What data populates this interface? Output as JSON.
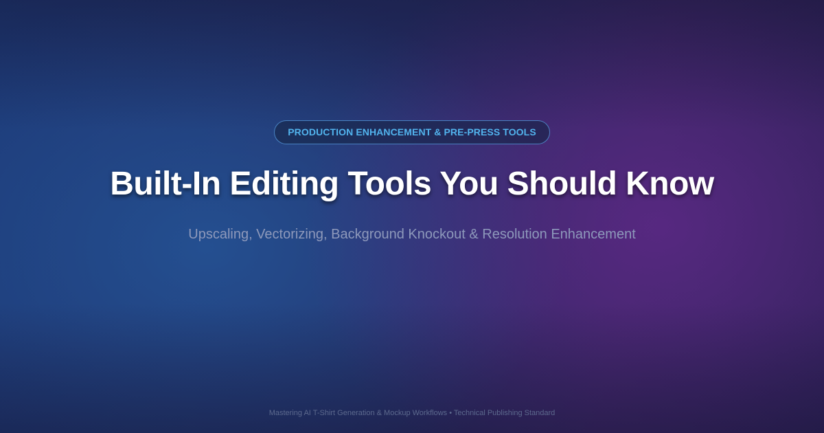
{
  "badge": {
    "label": "PRODUCTION ENHANCEMENT & PRE-PRESS TOOLS"
  },
  "headline": {
    "title": "Built-In Editing Tools You Should Know",
    "subtitle": "Upscaling, Vectorizing, Background Knockout & Resolution Enhancement"
  },
  "footer": {
    "text": "Mastering AI T-Shirt Generation & Mockup Workflows • Technical Publishing Standard"
  },
  "colors": {
    "background_left": "#1d3a78",
    "background_right": "#35255f",
    "badge_text": "#52b4ee",
    "title": "#ffffff",
    "subtitle": "#8e99bb",
    "footer": "#5d6a8e"
  }
}
